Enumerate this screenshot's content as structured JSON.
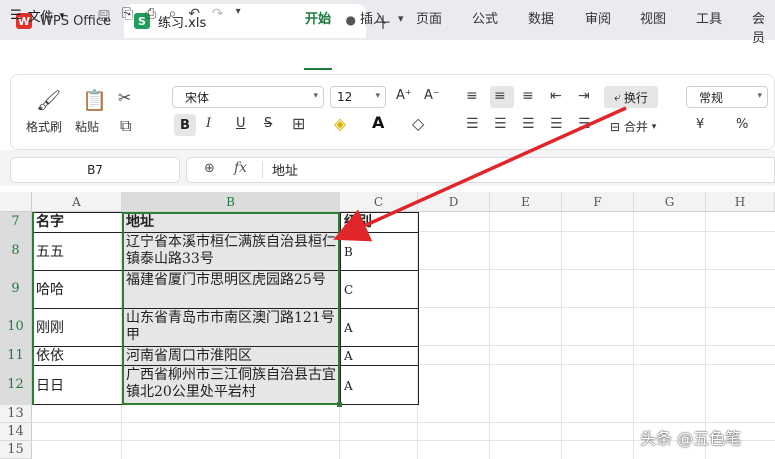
{
  "titlebar": {
    "app_tab": "WPS Office",
    "app_logo": "W",
    "file_tab": "练习.xls",
    "file_logo": "S"
  },
  "menu": {
    "file": "文件",
    "tabs": [
      "开始",
      "插入",
      "页面",
      "公式",
      "数据",
      "审阅",
      "视图",
      "工具",
      "会员"
    ]
  },
  "ribbon": {
    "format_painter": "格式刷",
    "paste": "粘贴",
    "font_name": "宋体",
    "font_size": "12",
    "wrap_text": "换行",
    "merge": "合并",
    "number_format": "常规",
    "bold": "B",
    "italic": "I",
    "underline": "U",
    "strike": "S",
    "currency": "¥",
    "percent": "%",
    "grow_font": "A⁺",
    "shrink_font": "A⁻"
  },
  "formula_bar": {
    "name_box": "B7",
    "fx": "fx",
    "value": "地址"
  },
  "columns": [
    "A",
    "B",
    "C",
    "D",
    "E",
    "F",
    "G",
    "H"
  ],
  "rows": [
    "7",
    "8",
    "9",
    "10",
    "11",
    "12",
    "13",
    "14",
    "15"
  ],
  "table": {
    "header": [
      "名字",
      "地址",
      "级别"
    ],
    "data": [
      [
        "五五",
        "辽宁省本溪市桓仁满族自治县桓仁镇泰山路33号",
        "B"
      ],
      [
        "哈哈",
        "福建省厦门市思明区虎园路25号",
        "C"
      ],
      [
        "刚刚",
        "山东省青岛市市南区澳门路121号甲",
        "A"
      ],
      [
        "依依",
        "河南省周口市淮阳区",
        "A"
      ],
      [
        "日日",
        "广西省柳州市三江侗族自治县古宜镇北20公里处平岩村",
        "A"
      ]
    ]
  },
  "annotation_color": "#e0262a",
  "accent": "#1c7d3c",
  "watermark": "头条 @五色笔"
}
